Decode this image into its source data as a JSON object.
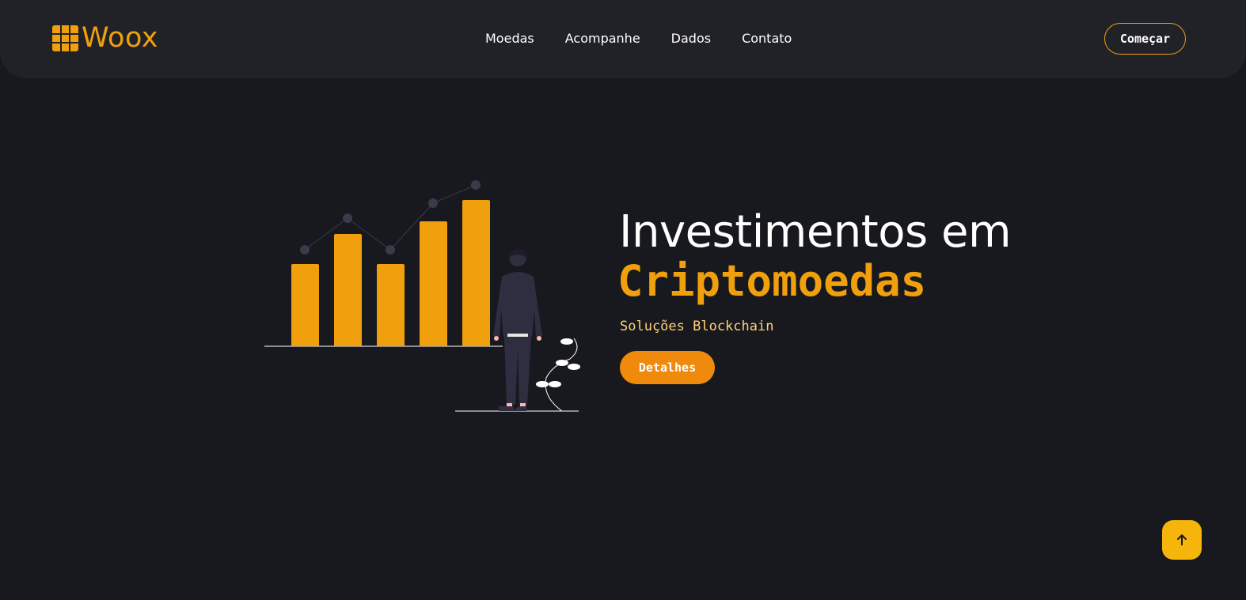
{
  "header": {
    "logo_text": "Woox",
    "logo_icon": "chip-icon",
    "nav_items": [
      {
        "label": "Moedas"
      },
      {
        "label": "Acompanhe"
      },
      {
        "label": "Dados"
      },
      {
        "label": "Contato"
      }
    ],
    "start_label": "Começar"
  },
  "hero": {
    "title": "Investimentos em",
    "highlight": "Criptomoedas",
    "subtitle": "Soluções Blockchain",
    "details_label": "Detalhes",
    "illustration": "growth-chart-person-illustration"
  },
  "scroll_top": {
    "icon": "arrow-up-icon"
  },
  "colors": {
    "background": "#18191e",
    "header": "#212227",
    "accent": "#f0a00c",
    "button": "#f08a0c",
    "subtitle": "#ffd27a",
    "scroll_button": "#f5b50a"
  }
}
